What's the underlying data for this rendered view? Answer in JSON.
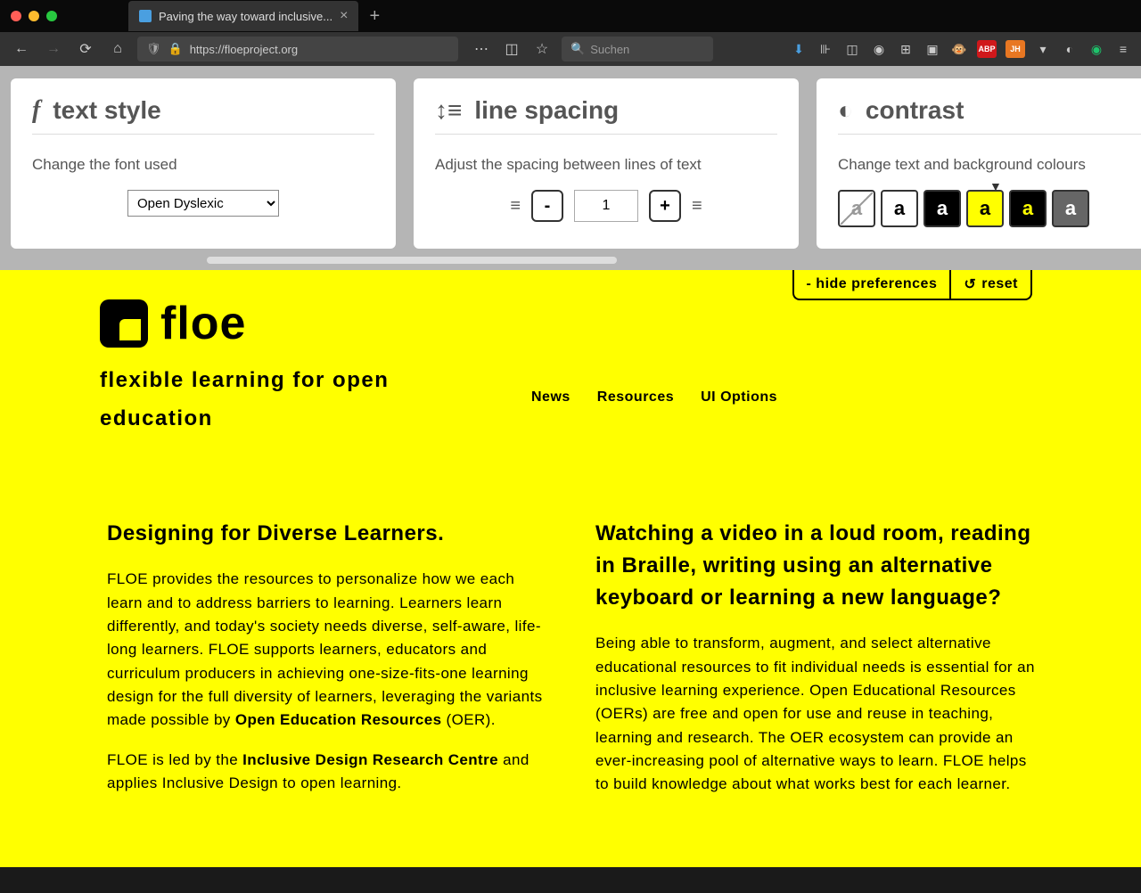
{
  "browser": {
    "tab_title": "Paving the way toward inclusive...",
    "url": "https://floeproject.org",
    "search_placeholder": "Suchen"
  },
  "prefs": {
    "text_style": {
      "title": "text style",
      "desc": "Change the font used",
      "selected": "Open Dyslexic"
    },
    "line_spacing": {
      "title": "line spacing",
      "desc": "Adjust the spacing between lines of text",
      "value": "1",
      "minus": "-",
      "plus": "+"
    },
    "contrast": {
      "title": "contrast",
      "desc": "Change text and background colours",
      "glyph": "a"
    }
  },
  "pref_tabs": {
    "hide": "- hide preferences",
    "reset": "reset"
  },
  "site": {
    "logo": "floe",
    "tagline": "flexible learning for open education",
    "nav": {
      "news": "News",
      "resources": "Resources",
      "ui": "UI Options"
    }
  },
  "col1": {
    "h": "Designing for Diverse Learners.",
    "p1a": "FLOE provides the resources to personalize how we each learn and to address barriers to learning. Learners learn differently, and today's society needs diverse, self-aware, life-long learners. FLOE supports learners, educators and curriculum producers in achieving one-size-fits-one learning design for the full diversity of learners, leveraging the variants made possible by ",
    "p1b": "Open Education Resources",
    "p1c": " (OER).",
    "p2a": "FLOE is led by the ",
    "p2b": "Inclusive Design Research Centre",
    "p2c": " and applies Inclusive Design to open learning."
  },
  "col2": {
    "h": "Watching a video in a loud room, reading in Braille, writing using an alternative keyboard or learning a new language?",
    "p": "Being able to transform, augment, and select alternative educational resources to fit individual needs is essential for an inclusive learning experience. Open Educational Resources (OERs) are free and open for use and reuse in teaching, learning and research. The OER ecosystem can provide an ever-increasing pool of alternative ways to learn. FLOE helps to build knowledge about what works best for each learner."
  }
}
